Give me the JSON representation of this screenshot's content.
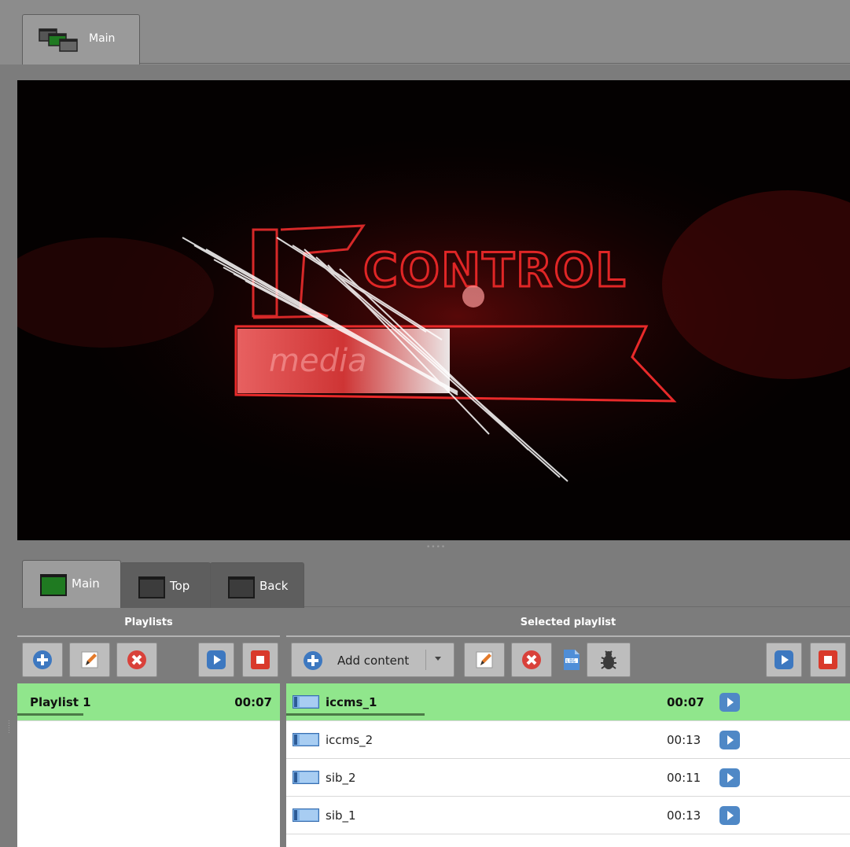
{
  "window_tabs": [
    {
      "label": "Main",
      "icon": "multi-screen-icon",
      "active": true
    }
  ],
  "preview": {
    "image": "video-preview-control-logo"
  },
  "channel_tabs": [
    {
      "label": "Main",
      "icon": "screen-green-icon",
      "active": true
    },
    {
      "label": "Top",
      "icon": "screen-dark-icon",
      "active": false
    },
    {
      "label": "Back",
      "icon": "screen-dark-icon",
      "active": false
    }
  ],
  "playlists_panel": {
    "header": "Playlists",
    "toolbar": [
      "add-icon",
      "edit-icon",
      "delete-icon",
      "play-icon",
      "stop-icon"
    ],
    "items": [
      {
        "name": "Playlist 1",
        "duration": "00:07",
        "selected": true,
        "progress": 0.25
      }
    ]
  },
  "selected_panel": {
    "header": "Selected playlist",
    "add_content_label": "Add content",
    "toolbar": [
      "add-icon",
      "add-content-dropdown",
      "edit-icon",
      "delete-icon",
      "log-icon",
      "bug-icon",
      "play-icon",
      "stop-icon"
    ],
    "items": [
      {
        "name": "iccms_1",
        "duration": "00:07",
        "selected": true,
        "progress": 0.25
      },
      {
        "name": "iccms_2",
        "duration": "00:13",
        "selected": false
      },
      {
        "name": "sib_2",
        "duration": "00:11",
        "selected": false
      },
      {
        "name": "sib_1",
        "duration": "00:13",
        "selected": false
      }
    ]
  },
  "colors": {
    "selected_row": "#90e68c",
    "progress": "#4b7a47",
    "play_blue": "#4f88c6",
    "stop_red": "#d93a2b"
  }
}
